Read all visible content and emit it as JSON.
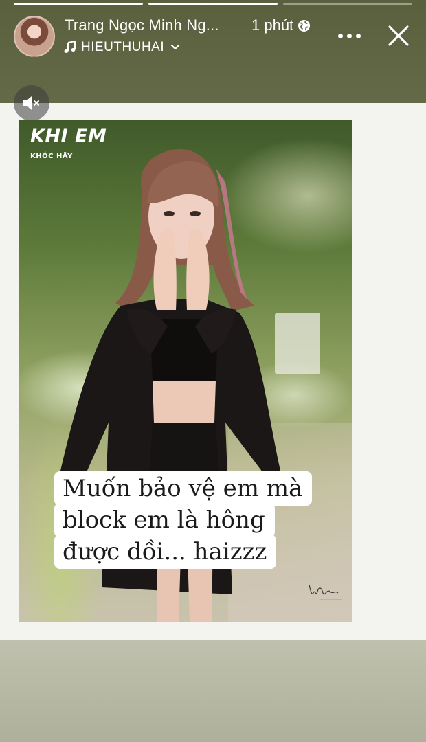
{
  "story": {
    "progress": [
      1.0,
      1.0,
      0.0
    ]
  },
  "header": {
    "author_name": "Trang Ngọc Minh Ng...",
    "timestamp": "1 phút",
    "music_label": "HIEUTHUHAI",
    "icons": {
      "privacy": "globe-icon",
      "music": "music-note-icon",
      "expand": "chevron-down-icon",
      "more": "more-horizontal-icon",
      "close": "close-icon",
      "mute": "speaker-muted-icon"
    }
  },
  "photo": {
    "title": "KHI EM",
    "subtitle": "KHÓC HÃY"
  },
  "caption": {
    "lines": [
      "Muốn bảo vệ em mà",
      "block em là hông",
      "được dồi... haizzz"
    ]
  },
  "colors": {
    "top_bar": "#5f6543",
    "card": "#f3f3f0",
    "bottom": "#b8b9a5",
    "text": "#ffffff"
  }
}
